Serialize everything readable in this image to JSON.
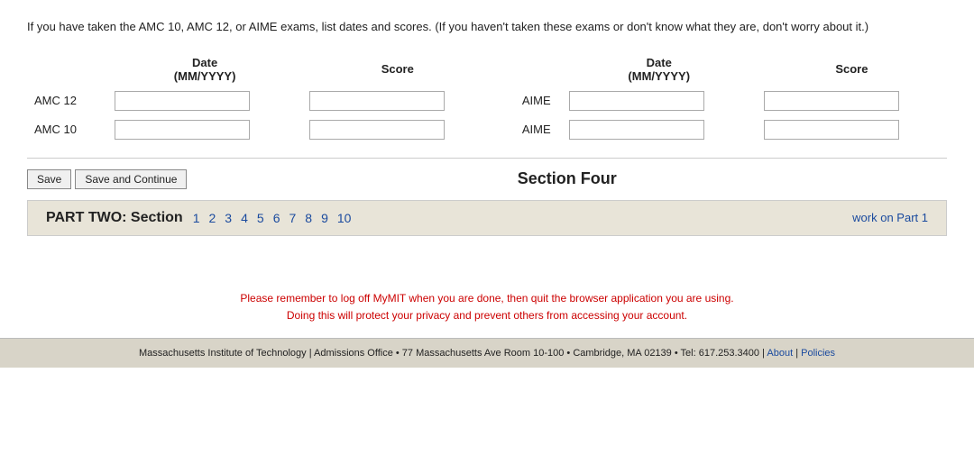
{
  "intro": {
    "text": "If you have taken the AMC 10, AMC 12, or AIME exams, list dates and scores. (If you haven't taken these exams or don't know what they are, don't worry about it.)"
  },
  "table": {
    "col1_date_label": "Date",
    "col1_date_sub": "(MM/YYYY)",
    "col1_score_label": "Score",
    "col2_date_label": "Date",
    "col2_date_sub": "(MM/YYYY)",
    "col2_score_label": "Score",
    "rows": [
      {
        "left_label": "AMC 12",
        "right_label": "AIME"
      },
      {
        "left_label": "AMC 10",
        "right_label": "AIME"
      }
    ]
  },
  "buttons": {
    "save_label": "Save",
    "save_continue_label": "Save and Continue"
  },
  "section_title": "Section Four",
  "part_two": {
    "label": "PART TWO: Section",
    "sections": [
      "1",
      "2",
      "3",
      "4",
      "5",
      "6",
      "7",
      "8",
      "9",
      "10"
    ],
    "work_on_part1": "work on Part 1"
  },
  "privacy": {
    "line1": "Please remember to log off MyMIT when you are done, then quit the browser application you are using.",
    "line2": "Doing this will protect your privacy and prevent others from accessing your account."
  },
  "footer": {
    "text": "Massachusetts Institute of Technology | Admissions Office • 77 Massachusetts Ave Room 10-100 • Cambridge, MA 02139 • Tel: 617.253.3400 |",
    "about_label": "About",
    "pipe": "|",
    "policies_label": "Policies"
  }
}
